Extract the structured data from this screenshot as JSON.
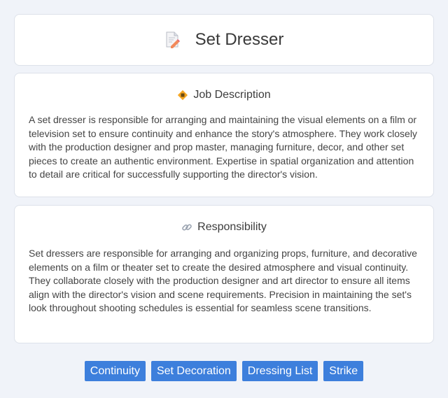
{
  "header": {
    "title": "Set Dresser",
    "icon": "document-pencil-icon"
  },
  "job_description": {
    "heading": "Job Description",
    "icon": "diamond-badge-icon",
    "text": "A set dresser is responsible for arranging and maintaining the visual elements on a film or television set to ensure continuity and enhance the story's atmosphere. They work closely with the production designer and prop master, managing furniture, decor, and other set pieces to create an authentic environment. Expertise in spatial organization and attention to detail are critical for successfully supporting the director's vision."
  },
  "responsibility": {
    "heading": "Responsibility",
    "icon": "link-icon",
    "text": "Set dressers are responsible for arranging and organizing props, furniture, and decorative elements on a film or theater set to create the desired atmosphere and visual continuity. They collaborate closely with the production designer and art director to ensure all items align with the director's vision and scene requirements. Precision in maintaining the set's look throughout shooting schedules is essential for seamless scene transitions."
  },
  "tags": [
    "Continuity",
    "Set Decoration",
    "Dressing List",
    "Strike"
  ],
  "colors": {
    "tag_bg": "#3d7fdc",
    "page_bg": "#f0f3f9"
  }
}
